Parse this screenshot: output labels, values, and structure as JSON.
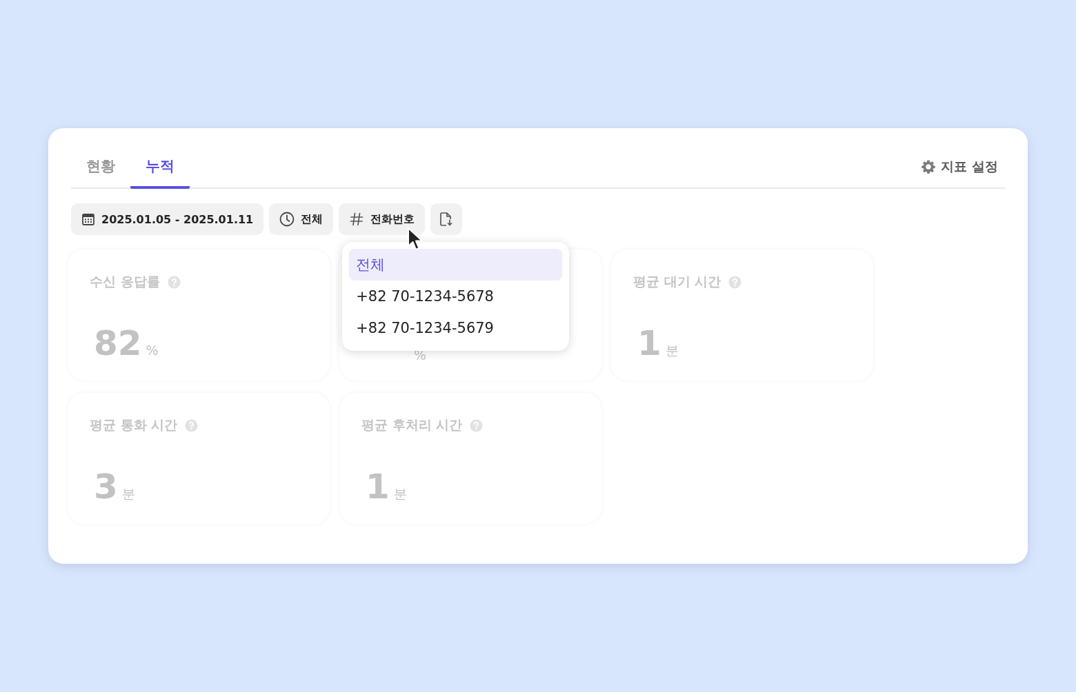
{
  "tabs": [
    {
      "label": "현황",
      "selected": false
    },
    {
      "label": "누적",
      "selected": true
    }
  ],
  "settings_button": {
    "label": "지표 설정"
  },
  "filters": [
    {
      "kind": "date",
      "label": "2025.01.05 - 2025.01.11"
    },
    {
      "kind": "time",
      "label": "전체"
    },
    {
      "kind": "tag",
      "label": "전화번호",
      "open": true
    },
    {
      "kind": "export"
    }
  ],
  "dropdown": {
    "items": [
      {
        "label": "전체",
        "selected": true
      },
      {
        "label": "+82 70-1234-5678",
        "selected": false
      },
      {
        "label": "+82 70-1234-5679",
        "selected": false
      }
    ]
  },
  "cards": [
    {
      "title": "수신 응답률",
      "value": "82",
      "unit": "%"
    },
    {
      "unit": "%"
    },
    {
      "title": "평균 대기 시간",
      "value": "1",
      "unit": "분"
    },
    {
      "title": "평균 통화 시간",
      "value": "3",
      "unit": "분"
    },
    {
      "title": "평균 후처리 시간",
      "value": "1",
      "unit": "분"
    }
  ]
}
